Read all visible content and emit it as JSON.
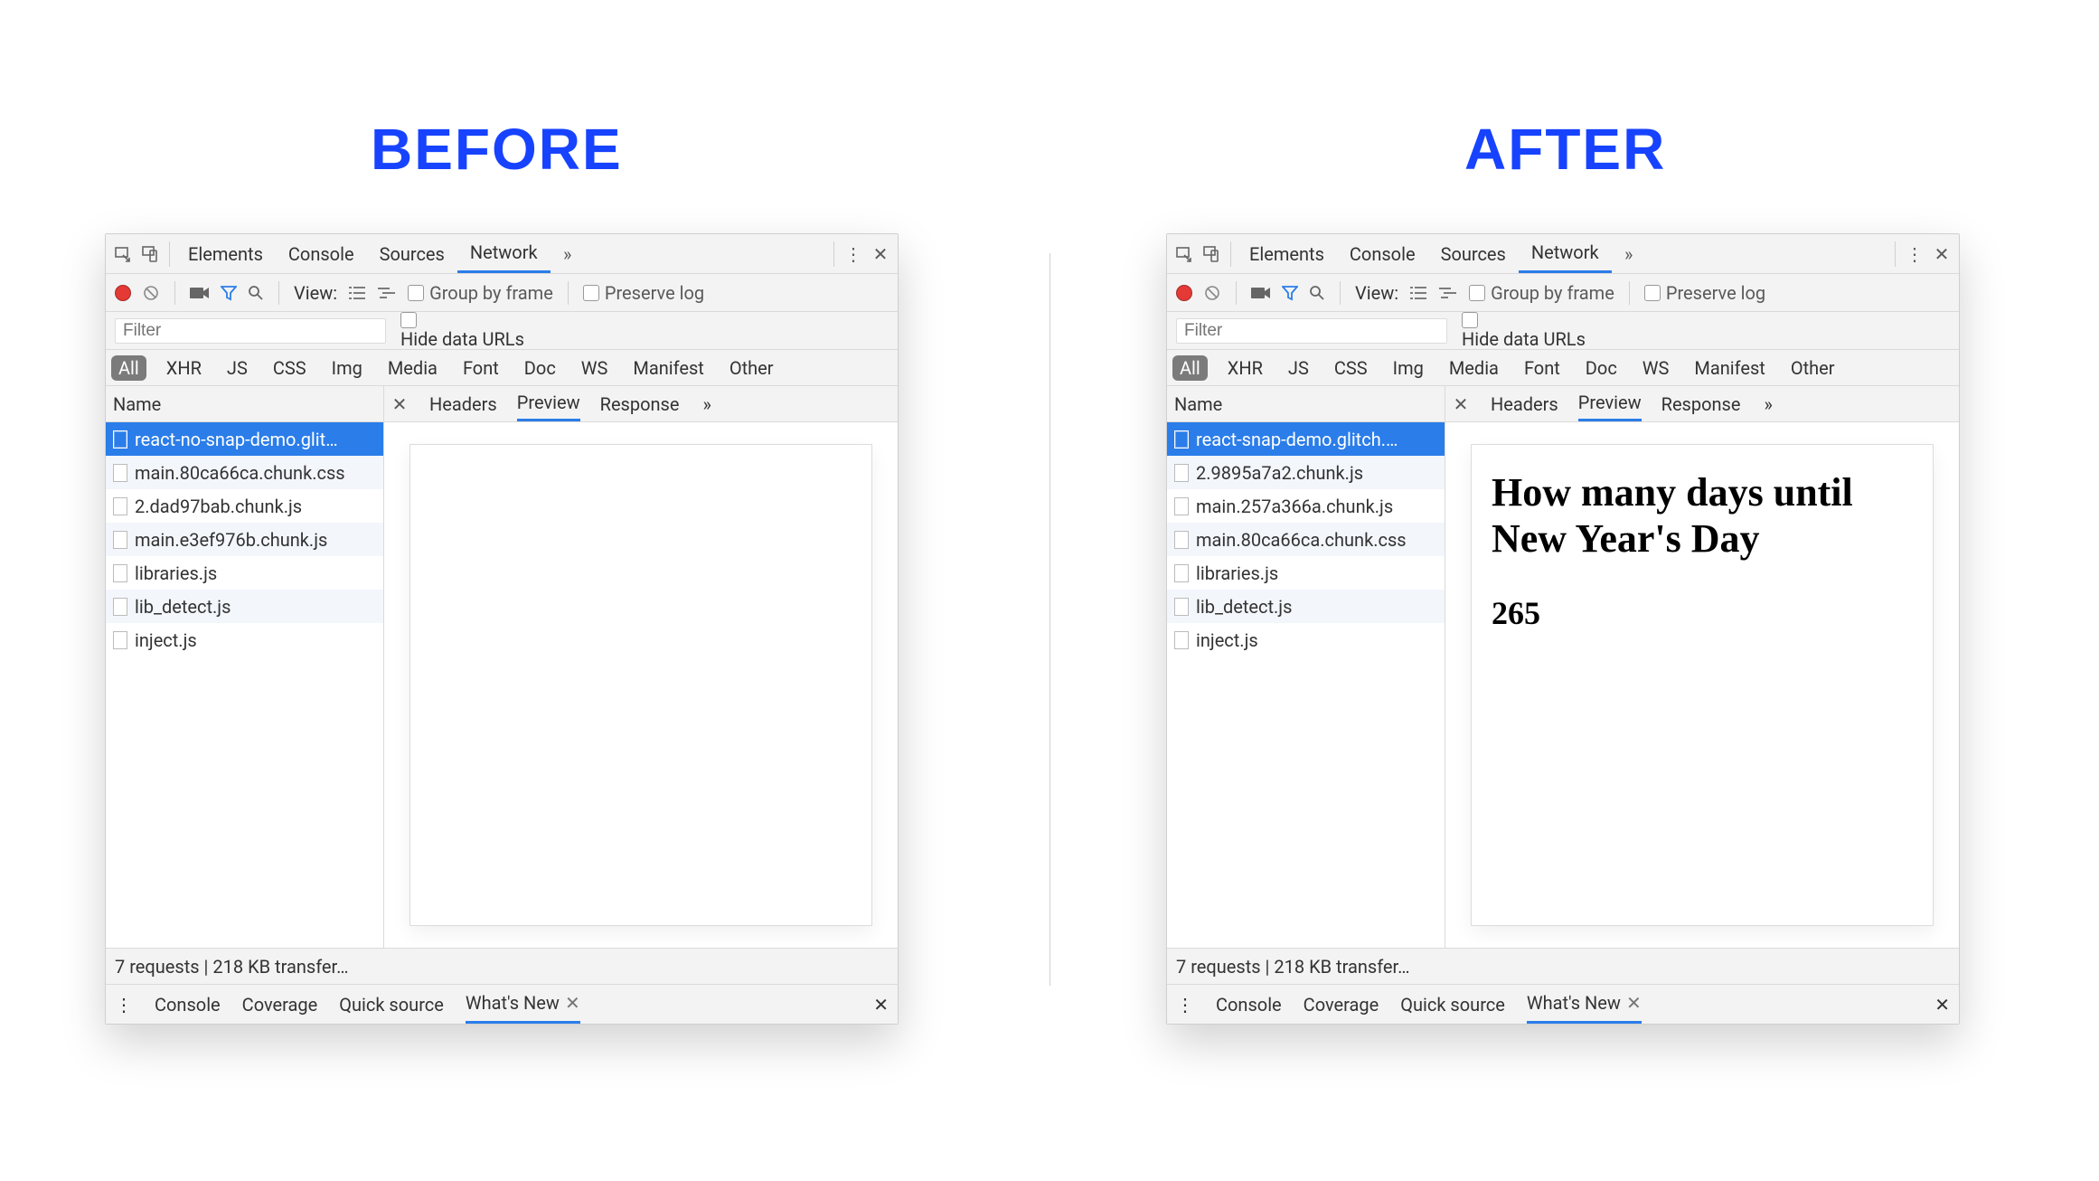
{
  "headings": {
    "before": "BEFORE",
    "after": "AFTER"
  },
  "common": {
    "topTabs": [
      "Elements",
      "Console",
      "Sources",
      "Network"
    ],
    "activeTopTab": "Network",
    "toolbar": {
      "viewLabel": "View:",
      "groupByFrame": "Group by frame",
      "preserveLog": "Preserve log"
    },
    "filter": {
      "placeholder": "Filter",
      "hideDataUrls": "Hide data URLs"
    },
    "typeChips": [
      "All",
      "XHR",
      "JS",
      "CSS",
      "Img",
      "Media",
      "Font",
      "Doc",
      "WS",
      "Manifest",
      "Other"
    ],
    "activeChip": "All",
    "leftColHeader": "Name",
    "detailTabs": [
      "Headers",
      "Preview",
      "Response"
    ],
    "activeDetailTab": "Preview",
    "status": "7 requests | 218 KB transfer…",
    "drawerTabs": [
      "Console",
      "Coverage",
      "Quick source",
      "What's New"
    ],
    "activeDrawerTab": "What's New"
  },
  "beforePanel": {
    "requests": [
      "react-no-snap-demo.glit…",
      "main.80ca66ca.chunk.css",
      "2.dad97bab.chunk.js",
      "main.e3ef976b.chunk.js",
      "libraries.js",
      "lib_detect.js",
      "inject.js"
    ],
    "preview": {
      "heading": "",
      "sub": ""
    }
  },
  "afterPanel": {
    "requests": [
      "react-snap-demo.glitch.…",
      "2.9895a7a2.chunk.js",
      "main.257a366a.chunk.js",
      "main.80ca66ca.chunk.css",
      "libraries.js",
      "lib_detect.js",
      "inject.js"
    ],
    "preview": {
      "heading": "How many days until New Year's Day",
      "sub": "265"
    }
  }
}
